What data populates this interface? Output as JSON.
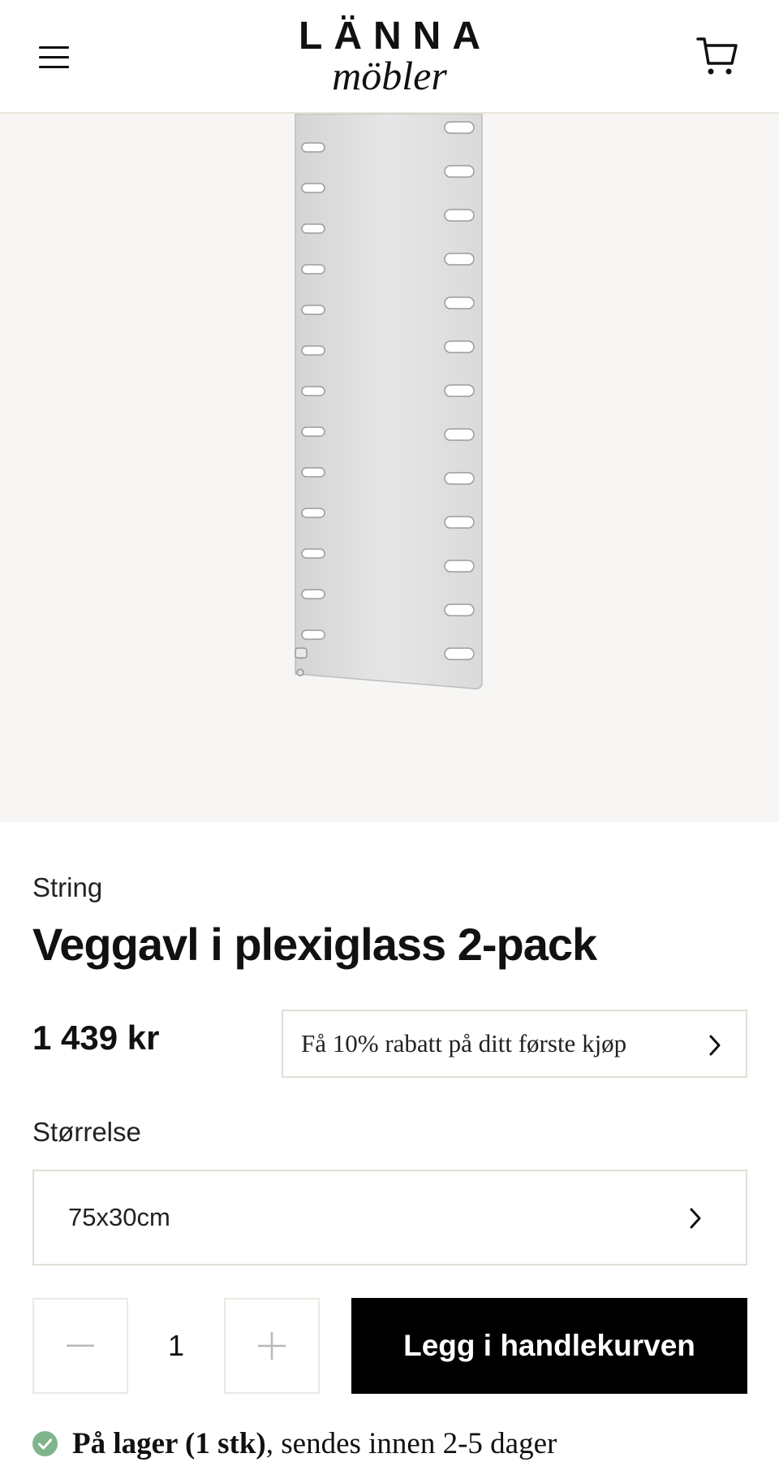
{
  "header": {
    "logo_top": "LÄNNA",
    "logo_bottom": "möbler",
    "menu_icon": "hamburger-menu-icon",
    "cart_icon": "shopping-cart-icon"
  },
  "gallery": {
    "current_slide": 1
  },
  "product": {
    "brand": "String",
    "title": "Veggavl i plexiglass 2-pack",
    "price": "1 439 kr",
    "promo_text": "Få 10% rabatt på ditt første kjøp",
    "size_label": "Størrelse",
    "size_value": "75x30cm",
    "quantity": "1",
    "add_to_cart_label": "Legg i handlekurven",
    "stock_strong": "På lager (1 stk)",
    "stock_rest": ", sendes innen 2-5 dager"
  },
  "colors": {
    "accent": "#000000",
    "page_background": "#ffffff",
    "image_background": "#f7f6f4",
    "border": "#e2ded6",
    "stock_green": "#7fb58c"
  }
}
